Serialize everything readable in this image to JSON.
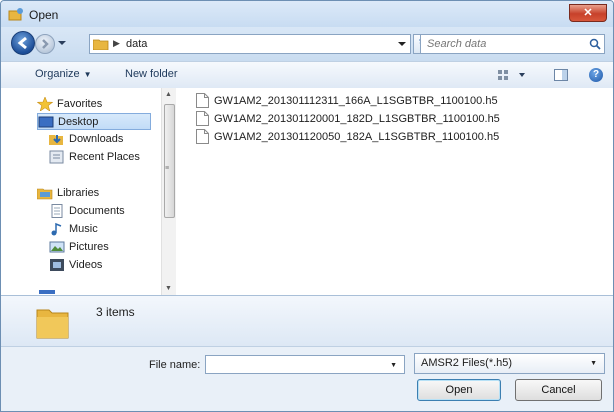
{
  "window": {
    "title": "Open"
  },
  "navbar": {
    "path_crumb": "data",
    "search_placeholder": "Search data"
  },
  "toolbar": {
    "organize_label": "Organize",
    "new_folder_label": "New folder"
  },
  "sidebar": {
    "favorites_label": "Favorites",
    "desktop_label": "Desktop",
    "downloads_label": "Downloads",
    "recent_label": "Recent Places",
    "libraries_label": "Libraries",
    "documents_label": "Documents",
    "music_label": "Music",
    "pictures_label": "Pictures",
    "videos_label": "Videos"
  },
  "files": [
    "GW1AM2_201301112311_166A_L1SGBTBR_1100100.h5",
    "GW1AM2_201301120001_182D_L1SGBTBR_1100100.h5",
    "GW1AM2_201301120050_182A_L1SGBTBR_1100100.h5"
  ],
  "details": {
    "item_count": "3 items"
  },
  "bottom": {
    "file_name_label": "File name:",
    "file_name_value": "",
    "file_type": "AMSR2 Files(*.h5)",
    "open_label": "Open",
    "cancel_label": "Cancel"
  },
  "colors": {
    "accent": "#1d4e98",
    "close": "#c7412a",
    "folder": "#e8b640"
  },
  "icons": [
    "app-icon",
    "close-icon",
    "back-arrow-icon",
    "forward-arrow-icon",
    "folder-icon",
    "refresh-icon",
    "search-icon",
    "views-icon",
    "preview-pane-icon",
    "help-icon",
    "star-icon",
    "desktop-icon",
    "downloads-icon",
    "recent-places-icon",
    "libraries-icon",
    "documents-icon",
    "music-icon",
    "pictures-icon",
    "videos-icon",
    "file-icon"
  ]
}
